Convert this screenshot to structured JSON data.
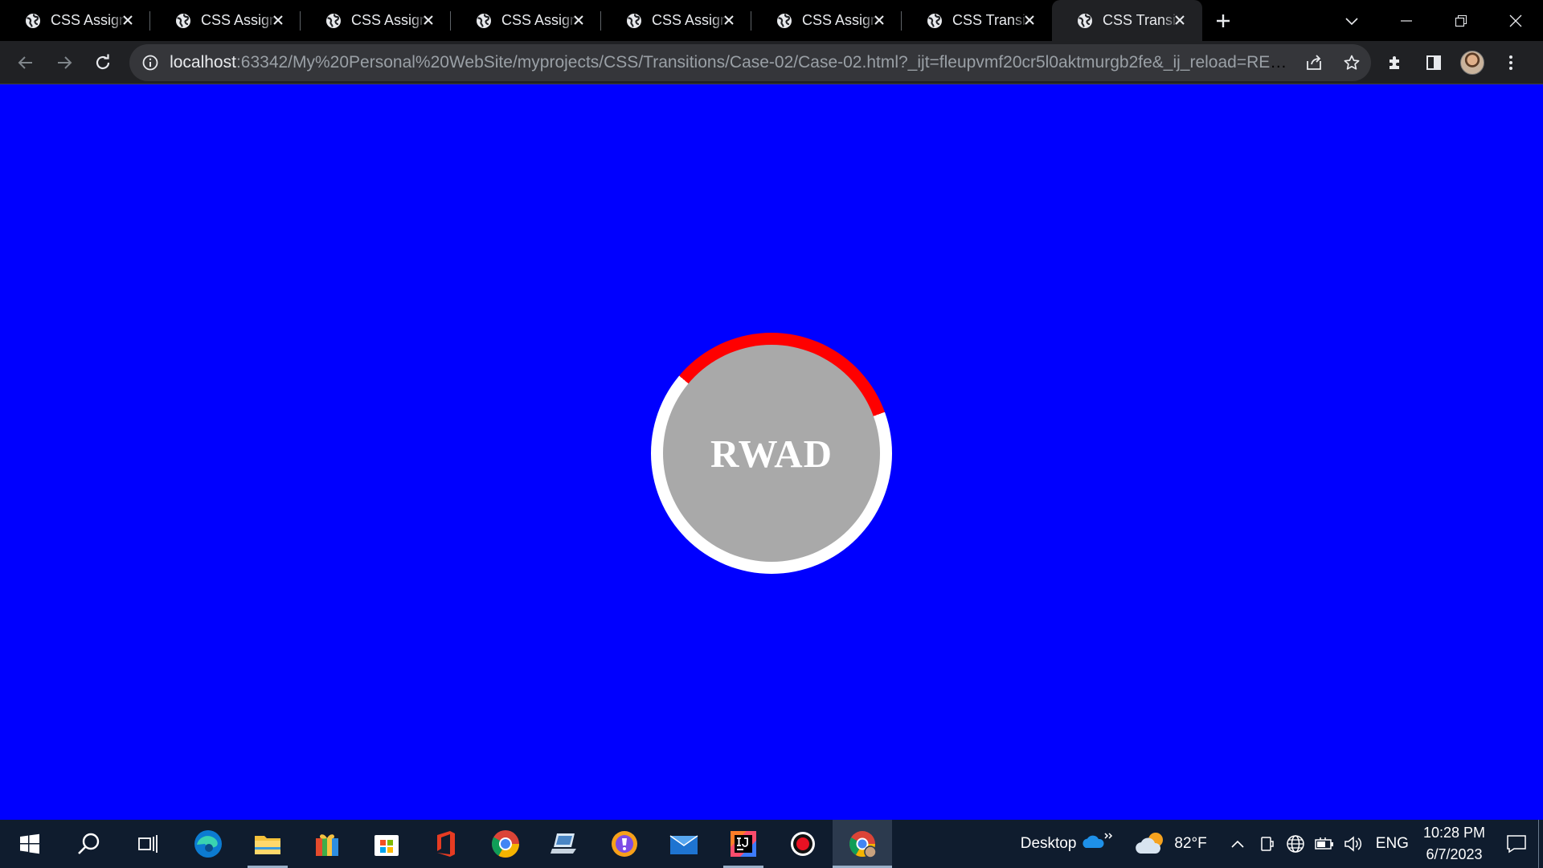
{
  "browser": {
    "tabs": [
      {
        "title": "CSS Assignment",
        "icon": "globe-icon"
      },
      {
        "title": "CSS Assignment",
        "icon": "globe-icon"
      },
      {
        "title": "CSS Assignment",
        "icon": "globe-icon"
      },
      {
        "title": "CSS Assignment",
        "icon": "globe-icon"
      },
      {
        "title": "CSS Assignment",
        "icon": "globe-icon"
      },
      {
        "title": "CSS Assignment",
        "icon": "globe-icon"
      },
      {
        "title": "CSS Transitions",
        "icon": "globe-icon"
      },
      {
        "title": "CSS Transitions",
        "icon": "globe-icon",
        "active": true
      }
    ],
    "address_bar": {
      "host": "localhost",
      "path": ":63342/My%20Personal%20WebSite/myprojects/CSS/Transitions/Case-02/Case-02.html?_ijt=fleupvmf20cr5l0aktmurgb2fe&_ij_reload=RELOAD_ON_SAVE"
    },
    "colors": {
      "frame": "#000000",
      "toolbar": "#202124",
      "omnibox": "#35363a"
    }
  },
  "page": {
    "background": "#0000ff",
    "badge": {
      "text": "RWAD",
      "ring_color": "#ffffff",
      "ring_accent_color": "#ff0000",
      "fill_color": "#a9a9a9"
    }
  },
  "taskbar": {
    "apps": [
      "start-icon",
      "search-icon",
      "task-view-icon",
      "edge-icon",
      "file-explorer-icon",
      "gift-app-icon",
      "microsoft-store-icon",
      "office-icon",
      "chrome-icon",
      "laptop-app-icon",
      "vpn-icon",
      "mail-icon",
      "intellij-icon",
      "record-icon",
      "chrome-profile-icon"
    ],
    "tray": {
      "desktop_label": "Desktop",
      "temperature": "82°F",
      "language": "ENG",
      "time": "10:28 PM",
      "date": "6/7/2023"
    }
  }
}
